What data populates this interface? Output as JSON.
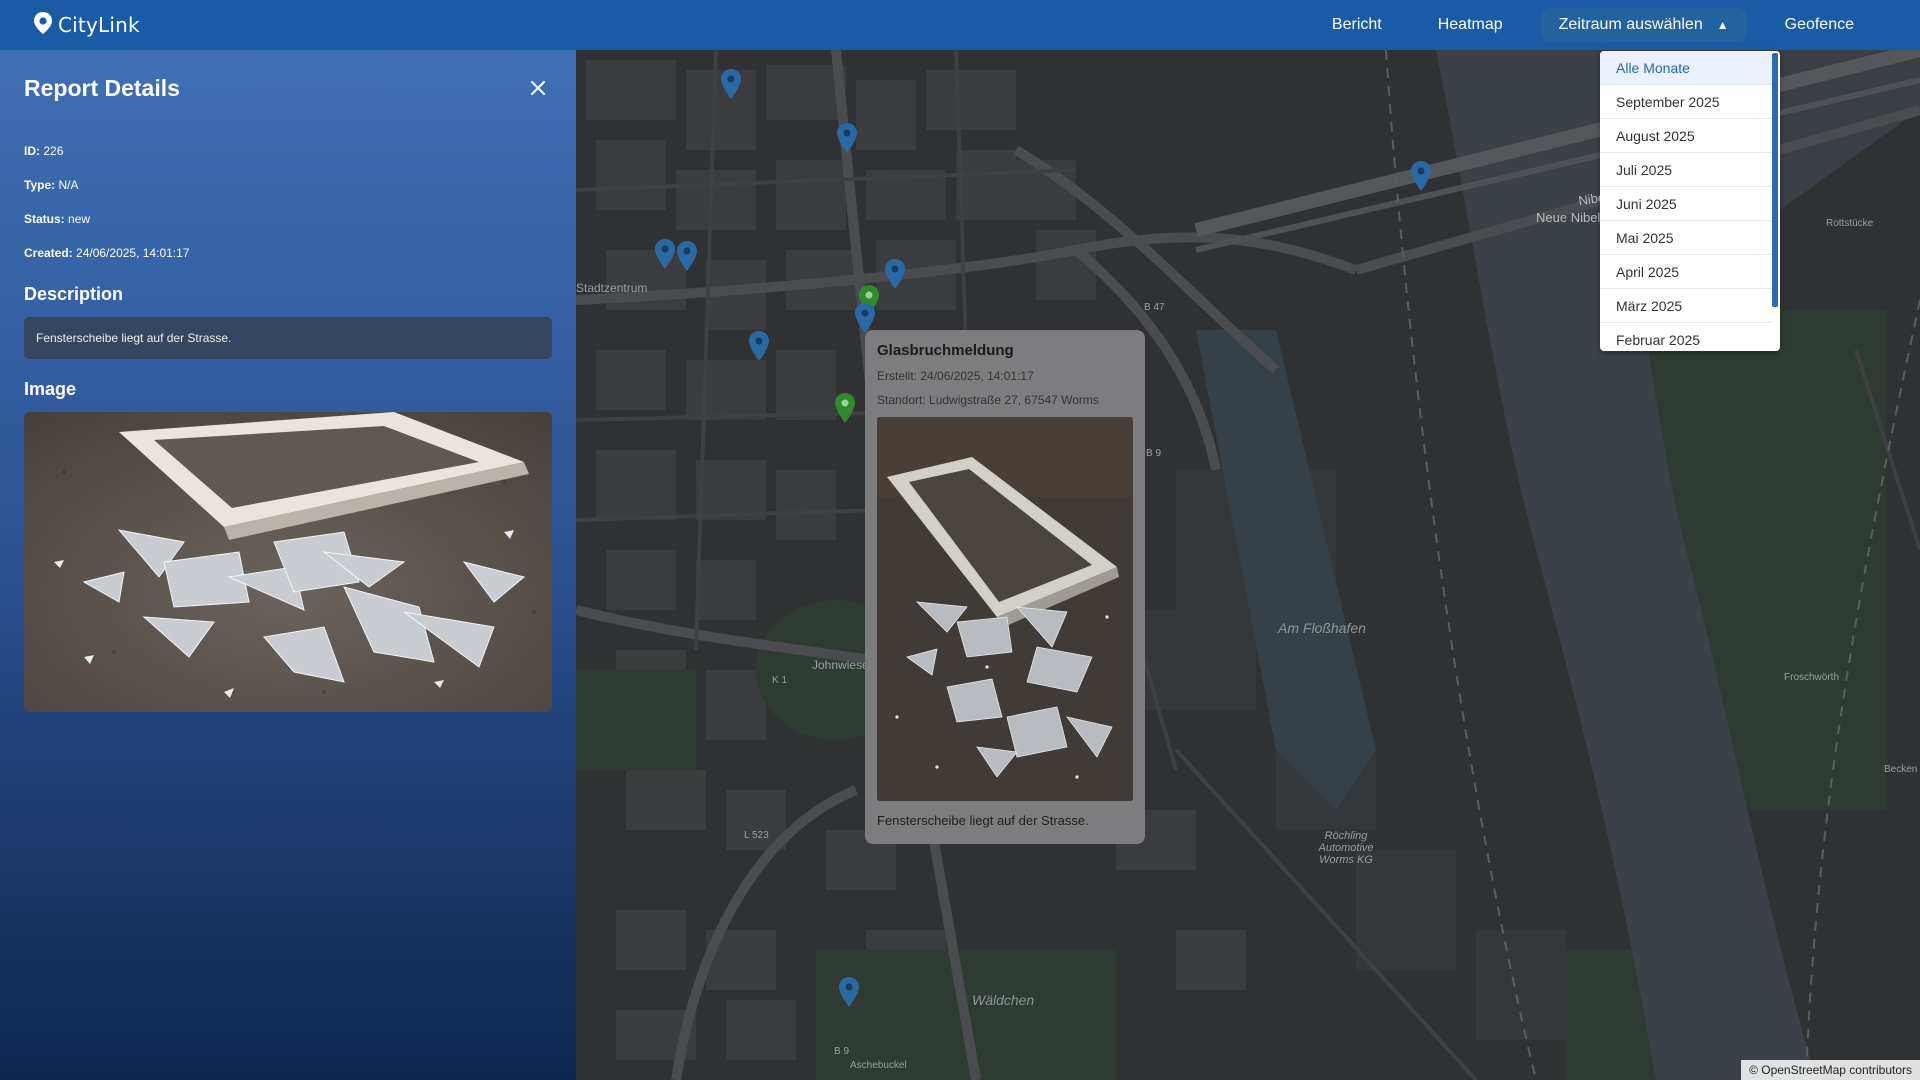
{
  "app": {
    "brand": "CityLink"
  },
  "nav": {
    "items": [
      "Bericht",
      "Heatmap"
    ],
    "period_label": "Zeitraum auswählen",
    "period_caret": "▲",
    "geofence_label": "Geofence"
  },
  "sidebar": {
    "title": "Report Details",
    "id_label": "ID:",
    "id_value": "226",
    "type_label": "Type:",
    "type_value": "N/A",
    "status_label": "Status:",
    "status_value": "new",
    "created_label": "Created:",
    "created_value": "24/06/2025, 14:01:17",
    "description_heading": "Description",
    "description_text": "Fensterscheibe liegt auf der Strasse.",
    "image_heading": "Image"
  },
  "popup": {
    "title": "Glasbruchmeldung",
    "created": "Erstellt: 24/06/2025, 14:01:17",
    "location": "Standort: Ludwigstraße 27, 67547 Worms",
    "description": "Fensterscheibe liegt auf der Strasse."
  },
  "dropdown": {
    "options": [
      "Alle Monate",
      "September 2025",
      "August 2025",
      "Juli 2025",
      "Juni 2025",
      "Mai 2025",
      "April 2025",
      "März 2025",
      "Februar 2025"
    ],
    "selected": "Alle Monate"
  },
  "map": {
    "labels": {
      "stadtzentrum": "Stadtzentrum",
      "bridge1": "Nibelungenbrücke",
      "bridge2": "Neue Nibelungenbrücke",
      "flosshafen": "Am Floßhafen",
      "waldchen": "Wäldchen",
      "johnwiese": "Johnwiese",
      "rottstucke": "Rottstücke",
      "froschworth": "Froschwörth",
      "becken": "Becken",
      "roechling": "Röchling Automotive Worms KG",
      "b47": "B 47",
      "b9a": "B 9",
      "b9b": "B 9",
      "k1": "K 1",
      "l523": "L 523",
      "aschebuckel": "Aschebuckel"
    },
    "attribution": "© OpenStreetMap contributors"
  },
  "colors": {
    "nav_bg": "#1a5ba6",
    "marker_blue": "#2a6aa3",
    "marker_green": "#2f8a2b",
    "dropdown_active": "#2867b2"
  }
}
